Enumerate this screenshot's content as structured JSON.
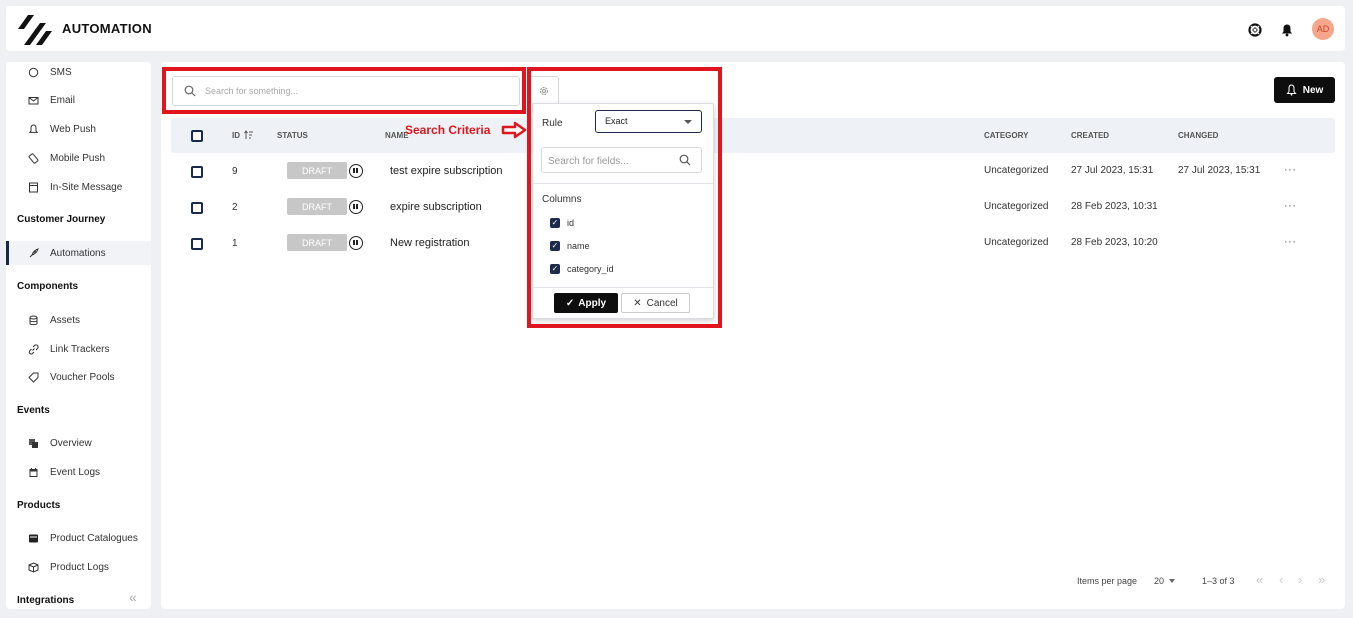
{
  "header": {
    "title": "AUTOMATION",
    "avatar_initials": "AD"
  },
  "sidebar": {
    "items": [
      {
        "label": "SMS",
        "icon": "chat-bubble-icon"
      },
      {
        "label": "Email",
        "icon": "mail-icon"
      },
      {
        "label": "Web Push",
        "icon": "bell-outline-icon"
      },
      {
        "label": "Mobile Push",
        "icon": "mobile-push-icon"
      },
      {
        "label": "In-Site Message",
        "icon": "window-icon"
      }
    ],
    "sections": {
      "customer_journey": "Customer Journey",
      "components": "Components",
      "events": "Events",
      "products": "Products",
      "integrations": "Integrations"
    },
    "journey_items": [
      {
        "label": "Automations",
        "icon": "rocket-icon"
      }
    ],
    "component_items": [
      {
        "label": "Assets",
        "icon": "database-icon"
      },
      {
        "label": "Link Trackers",
        "icon": "link-icon"
      },
      {
        "label": "Voucher Pools",
        "icon": "tag-icon"
      }
    ],
    "event_items": [
      {
        "label": "Overview",
        "icon": "overview-icon"
      },
      {
        "label": "Event Logs",
        "icon": "calendar-icon"
      }
    ],
    "product_items": [
      {
        "label": "Product Catalogues",
        "icon": "catalogue-icon"
      },
      {
        "label": "Product Logs",
        "icon": "box-icon"
      }
    ]
  },
  "toolbar": {
    "search_placeholder": "Search for something...",
    "new_label": "New"
  },
  "table": {
    "headers": {
      "id": "ID",
      "status": "STATUS",
      "name": "NAME",
      "category": "CATEGORY",
      "created": "CREATED",
      "changed": "CHANGED"
    },
    "rows": [
      {
        "id": "9",
        "status": "DRAFT",
        "name": "test expire subscription",
        "category": "Uncategorized",
        "created": "27 Jul 2023, 15:31",
        "changed": "27 Jul 2023, 15:31"
      },
      {
        "id": "2",
        "status": "DRAFT",
        "name": "expire subscription",
        "category": "Uncategorized",
        "created": "28 Feb 2023, 10:31",
        "changed": ""
      },
      {
        "id": "1",
        "status": "DRAFT",
        "name": "New registration",
        "category": "Uncategorized",
        "created": "28 Feb 2023, 10:20",
        "changed": ""
      }
    ],
    "more_label": "···"
  },
  "popover": {
    "rule_label": "Rule",
    "rule_value": "Exact",
    "field_search_placeholder": "Search for fields...",
    "columns_label": "Columns",
    "columns": [
      {
        "label": "id",
        "checked": true
      },
      {
        "label": "name",
        "checked": true
      },
      {
        "label": "category_id",
        "checked": true
      }
    ],
    "apply_label": "Apply",
    "cancel_label": "Cancel"
  },
  "annotation": {
    "text": "Search Criteria",
    "color": "#e0161e"
  },
  "pagination": {
    "items_per_page_label": "Items per page",
    "page_size": "20",
    "range": "1–3 of 3"
  }
}
